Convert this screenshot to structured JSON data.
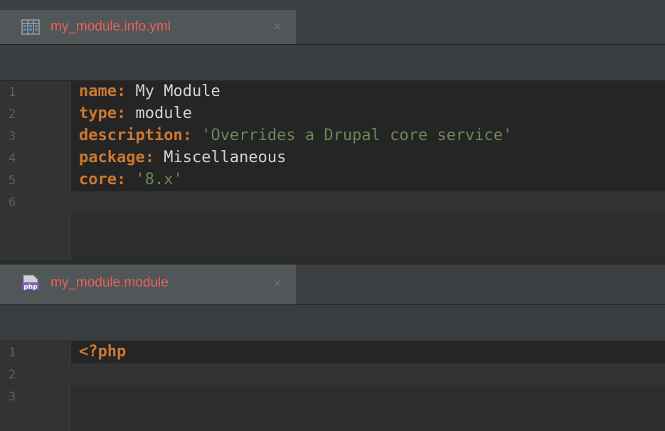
{
  "panes": [
    {
      "tab": {
        "filename": "my_module.info.yml",
        "icon": "yaml-file-icon",
        "close_symbol": "×"
      },
      "lines": [
        {
          "number": "1",
          "key": "name:",
          "value": " My Module",
          "value_type": "plain"
        },
        {
          "number": "2",
          "key": "type:",
          "value": " module",
          "value_type": "plain"
        },
        {
          "number": "3",
          "key": "description:",
          "value": " 'Overrides a Drupal core service'",
          "value_type": "string"
        },
        {
          "number": "4",
          "key": "package:",
          "value": " Miscellaneous",
          "value_type": "plain"
        },
        {
          "number": "5",
          "key": "core:",
          "value": " '8.x'",
          "value_type": "string"
        },
        {
          "number": "6",
          "key": "",
          "value": "",
          "value_type": "plain"
        }
      ]
    },
    {
      "tab": {
        "filename": "my_module.module",
        "icon": "php-file-icon",
        "icon_text": "php",
        "close_symbol": "×"
      },
      "lines": [
        {
          "number": "1",
          "code": "<?php"
        },
        {
          "number": "2",
          "code": ""
        },
        {
          "number": "3",
          "code": ""
        }
      ]
    }
  ],
  "colors": {
    "keyword": "#cc7832",
    "string": "#6a8759",
    "tab_label": "#e8625d",
    "background": "#2b2b2b"
  }
}
